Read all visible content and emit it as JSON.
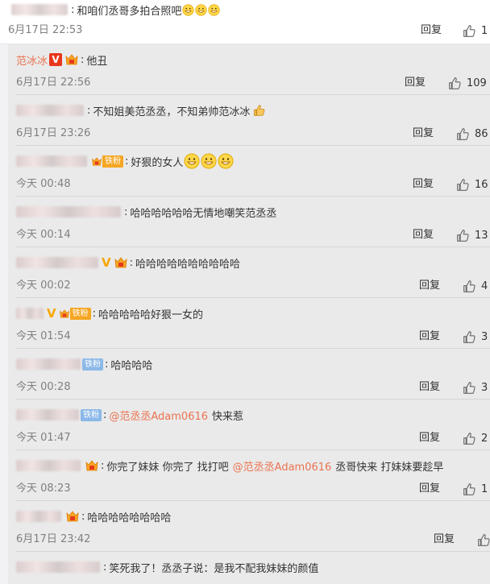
{
  "top_comment": {
    "text": "和咱们丞哥多拍合照吧",
    "time": "6月17日 22:53",
    "reply_label": "回复",
    "likes": "1"
  },
  "replies": [
    {
      "user": "范冰冰",
      "text": "他丑",
      "time": "6月17日 22:56",
      "reply_label": "回复",
      "likes": "109"
    },
    {
      "user": "",
      "text": "不知姐美范丞丞，不知弟帅范冰冰",
      "time": "6月17日 23:26",
      "reply_label": "回复",
      "likes": "86"
    },
    {
      "user": "",
      "fan_label": "铁粉",
      "text": "好狠的女人",
      "time": "今天 00:48",
      "reply_label": "回复",
      "likes": "16"
    },
    {
      "user": "",
      "text": "哈哈哈哈哈哈无情地嘲笑范丞丞",
      "time": "今天 00:14",
      "reply_label": "回复",
      "likes": "13"
    },
    {
      "user": "",
      "text": "哈哈哈哈哈哈哈哈哈哈",
      "time": "今天 00:02",
      "reply_label": "回复",
      "likes": "4"
    },
    {
      "user": "",
      "fan_label": "铁粉",
      "text": "哈哈哈哈哈好狠一女的",
      "time": "今天 01:54",
      "reply_label": "回复",
      "likes": "3"
    },
    {
      "user": "",
      "fan_label": "铁粉",
      "text": "哈哈哈哈",
      "time": "今天 00:28",
      "reply_label": "回复",
      "likes": "3"
    },
    {
      "user": "",
      "fan_label": "铁粉",
      "mention": "@范丞丞Adam0616",
      "text_after": "快来惹",
      "time": "今天 01:47",
      "reply_label": "回复",
      "likes": "2"
    },
    {
      "user": "",
      "text": "你完了妹妹 你完了 找打吧",
      "mention": "@范丞丞Adam0616",
      "text_after": "丞哥快来 打妹妹要趁早",
      "time": "今天 08:23",
      "reply_label": "回复",
      "likes": "1"
    },
    {
      "user": "",
      "text": "哈哈哈哈哈哈哈哈",
      "time": "6月17日 23:42",
      "reply_label": "回复",
      "likes": ""
    },
    {
      "user": "",
      "text": "笑死我了！丞丞子说：是我不配我妹妹的颜值"
    }
  ],
  "icons": {
    "like": "thumbs-up-icon",
    "verified_red": "verified-v-badge-icon",
    "verified_orange": "verified-v-orange-icon",
    "crown": "member-crown-icon",
    "grin": "grin-emoji-icon",
    "thumb_emoji": "thumbs-up-emoji-icon"
  },
  "colors": {
    "username": "#eb7350",
    "mention": "#eb7350",
    "time": "#808080",
    "fan_badge": "#f5a623",
    "fan_badge_blue": "#8bb8e8",
    "verified_red": "#e8371c"
  }
}
